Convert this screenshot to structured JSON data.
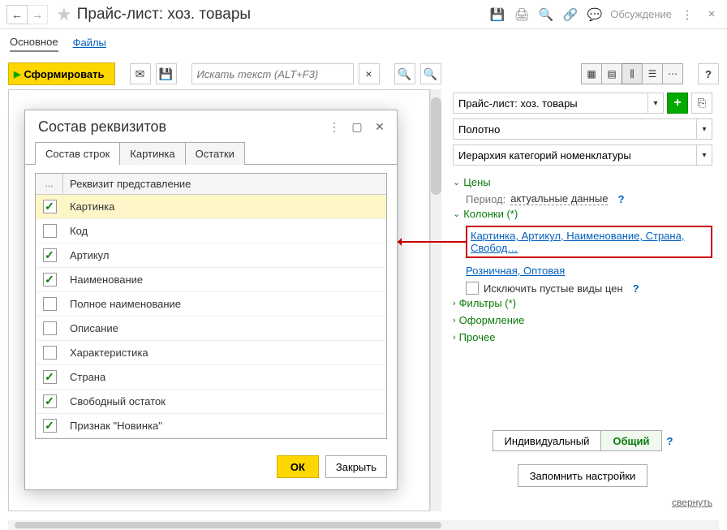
{
  "topbar": {
    "title": "Прайс-лист: хоз. товары",
    "discuss": "Обсуждение"
  },
  "tabs": {
    "main": "Основное",
    "files": "Файлы"
  },
  "toolbar": {
    "generate": "Сформировать",
    "search_placeholder": "Искать текст (ALT+F3)"
  },
  "right": {
    "combo_price_list": "Прайс-лист: хоз. товары",
    "combo_canvas": "Полотно",
    "combo_hierarchy": "Иерархия категорий номенклатуры",
    "sections": {
      "prices": {
        "title": "Цены",
        "period_label": "Период:",
        "period_value": "актуальные данные"
      },
      "columns": {
        "title": "Колонки (*)",
        "columns_link": "Картинка, Артикул, Наименование, Страна, Свобод…",
        "prices_link": "Розничная, Оптовая",
        "exclude_empty": "Исключить пустые виды цен"
      },
      "filters": "Фильтры (*)",
      "design": "Оформление",
      "other": "Прочее"
    },
    "mode": {
      "individual": "Индивидуальный",
      "general": "Общий"
    },
    "remember": "Запомнить настройки",
    "collapse": "свернуть"
  },
  "dialog": {
    "title": "Состав реквизитов",
    "tabs": {
      "rows": "Состав строк",
      "picture": "Картинка",
      "stock": "Остатки"
    },
    "header_col2": "Реквизит представление",
    "header_col1": "...",
    "rows": [
      {
        "label": "Картинка",
        "checked": true,
        "selected": true
      },
      {
        "label": "Код",
        "checked": false
      },
      {
        "label": "Артикул",
        "checked": true
      },
      {
        "label": "Наименование",
        "checked": true
      },
      {
        "label": "Полное наименование",
        "checked": false
      },
      {
        "label": "Описание",
        "checked": false
      },
      {
        "label": "Характеристика",
        "checked": false
      },
      {
        "label": "Страна",
        "checked": true
      },
      {
        "label": "Свободный остаток",
        "checked": true
      },
      {
        "label": "Признак \"Новинка\"",
        "checked": true
      }
    ],
    "ok": "ОК",
    "close": "Закрыть"
  }
}
